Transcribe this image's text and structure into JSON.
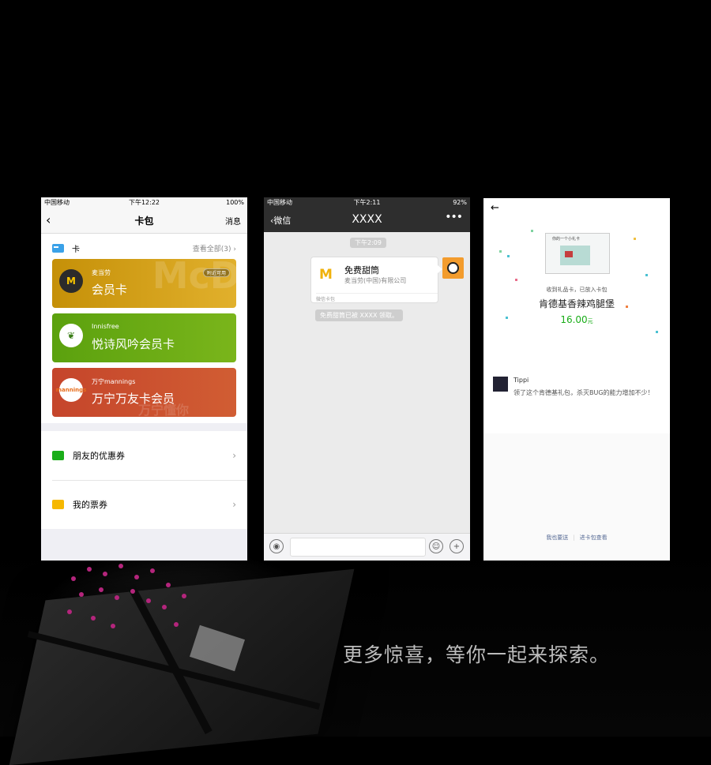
{
  "tagline": "更多惊喜，等你一起来探索。",
  "phone1": {
    "status": {
      "carrier": "中国移动",
      "time": "下午12:22",
      "battery": "100%"
    },
    "nav": {
      "back": "‹",
      "title": "卡包",
      "right": "消息"
    },
    "cards_section": {
      "label": "卡",
      "view_all": "查看全部(3) ›"
    },
    "cards": [
      {
        "brand": "麦当劳",
        "name": "会员卡",
        "badge": "附近可用",
        "logo": "M",
        "watermark": "McD"
      },
      {
        "brand": "Innisfree",
        "name": "悦诗风吟会员卡",
        "logo": "❦"
      },
      {
        "brand": "万宁mannings",
        "name": "万宁万友卡会员",
        "logo": "mannings",
        "watermark": "万宁懂你"
      }
    ],
    "list": [
      {
        "label": "朋友的优惠券",
        "color": "#1aad19"
      },
      {
        "label": "我的票券",
        "color": "#f6b800"
      }
    ],
    "chevron": "›"
  },
  "phone2": {
    "status": {
      "carrier": "中国移动",
      "time": "下午2:11",
      "battery": "92%"
    },
    "nav": {
      "back": "‹微信",
      "title": "XXXX",
      "more": "•••"
    },
    "time_pill": "下午2:09",
    "message": {
      "logo": "M",
      "title": "免费甜筒",
      "subtitle": "麦当劳(中国)有限公司",
      "footer": "微信卡包"
    },
    "system_message": "免费甜筒已被 XXXX 领取。",
    "input_bar": {
      "voice": "◉",
      "emoji": "☺",
      "plus": "+"
    }
  },
  "phone3": {
    "back": "←",
    "gift_caption": "你的一个小礼卡",
    "received": "收到礼品卡，已放入卡包",
    "gift_name": "肯德基香辣鸡腿堡",
    "price": "16.00",
    "price_unit": "元",
    "comment": {
      "user": "Tippi",
      "text": "领了这个肯德基礼包，杀灭BUG的能力增加不少！"
    },
    "actions": {
      "send": "我也要送",
      "view": "进卡包查看",
      "sep": "|"
    }
  }
}
